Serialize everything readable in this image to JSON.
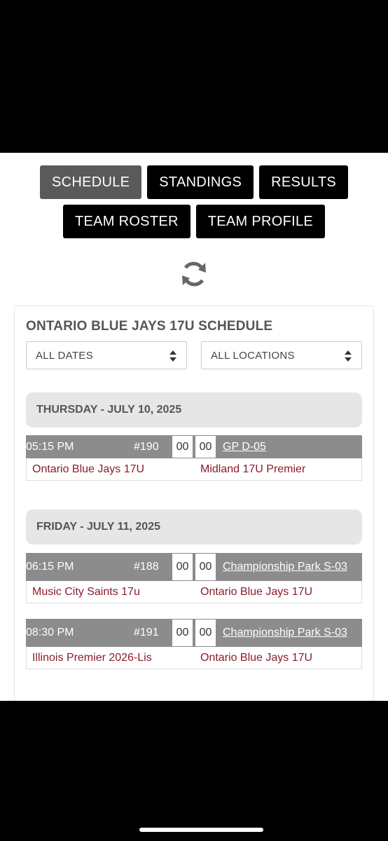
{
  "nav": {
    "schedule": "SCHEDULE",
    "standings": "STANDINGS",
    "results": "RESULTS",
    "team_roster": "TEAM ROSTER",
    "team_profile": "TEAM PROFILE"
  },
  "refresh_icon": "refresh-icon",
  "panel": {
    "title": "ONTARIO BLUE JAYS 17U SCHEDULE",
    "dates_filter": "ALL DATES",
    "locations_filter": "ALL LOCATIONS"
  },
  "days": [
    {
      "label": "THURSDAY - JULY 10, 2025",
      "games": [
        {
          "time": "05:15 PM",
          "number": "#190",
          "score_home": "00",
          "score_away": "00",
          "location": "GP D-05",
          "home": "Ontario Blue Jays 17U",
          "away": "Midland 17U Premier"
        }
      ]
    },
    {
      "label": "FRIDAY - JULY 11, 2025",
      "games": [
        {
          "time": "06:15 PM",
          "number": "#188",
          "score_home": "00",
          "score_away": "00",
          "location": "Championship Park S-03",
          "home": "Music City Saints 17u",
          "away": "Ontario Blue Jays 17U"
        },
        {
          "time": "08:30 PM",
          "number": "#191",
          "score_home": "00",
          "score_away": "00",
          "location": "Championship Park S-03",
          "home": "Illinois Premier 2026-Lis",
          "away": "Ontario Blue Jays 17U"
        }
      ]
    }
  ],
  "colors": {
    "team_link": "#8b1c2b",
    "game_bar": "#8c8c8c",
    "active_tab": "#5a5a5a"
  }
}
